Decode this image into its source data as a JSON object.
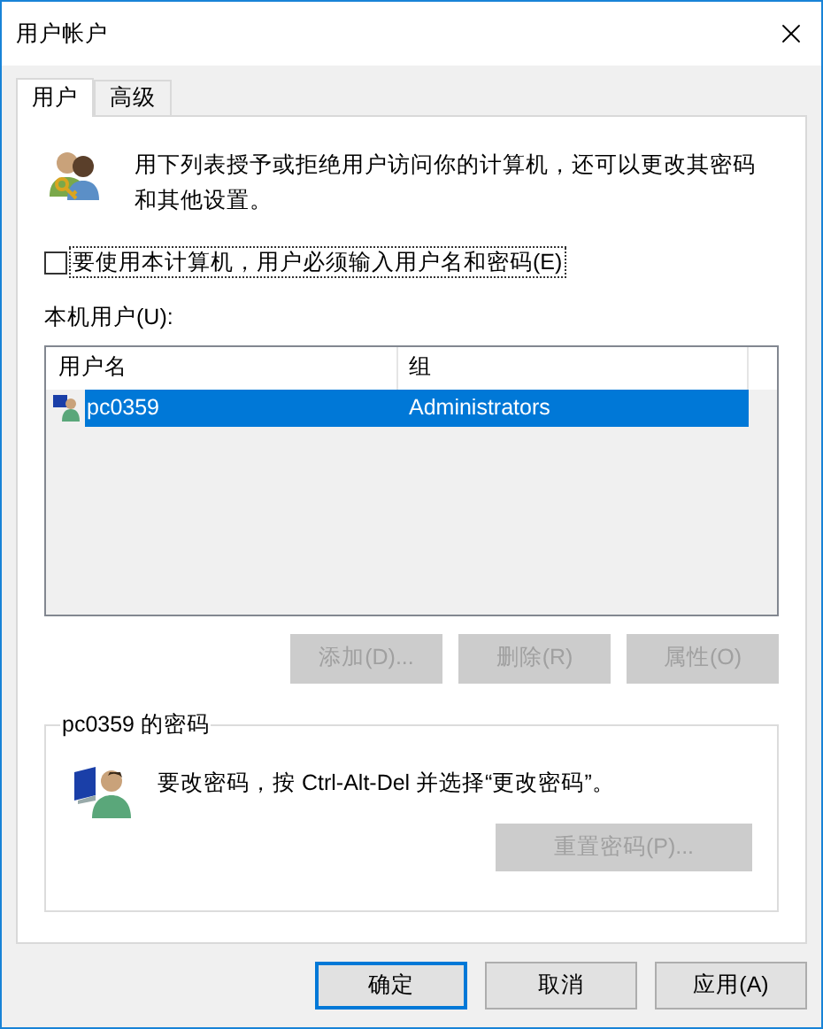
{
  "window": {
    "title": "用户帐户"
  },
  "tabs": [
    {
      "label": "用户",
      "selected": true
    },
    {
      "label": "高级",
      "selected": false
    }
  ],
  "description": "用下列表授予或拒绝用户访问你的计算机，还可以更改其密码和其他设置。",
  "require_password": {
    "label": "要使用本计算机，用户必须输入用户名和密码(E)",
    "checked": false
  },
  "users": {
    "label": "本机用户(U):",
    "columns": [
      "用户名",
      "组"
    ],
    "rows": [
      {
        "name": "pc0359",
        "group": "Administrators",
        "selected": true
      }
    ]
  },
  "user_buttons": [
    {
      "label": "添加(D)...",
      "disabled": true
    },
    {
      "label": "删除(R)",
      "disabled": true
    },
    {
      "label": "属性(O)",
      "disabled": true
    }
  ],
  "password_group": {
    "title": "pc0359 的密码",
    "text": "要改密码，按 Ctrl-Alt-Del 并选择“更改密码”。",
    "button": {
      "label": "重置密码(P)...",
      "disabled": true
    }
  },
  "buttons": [
    {
      "label": "确定",
      "default": true
    },
    {
      "label": "取消",
      "default": false
    },
    {
      "label": "应用(A)",
      "default": false
    }
  ]
}
